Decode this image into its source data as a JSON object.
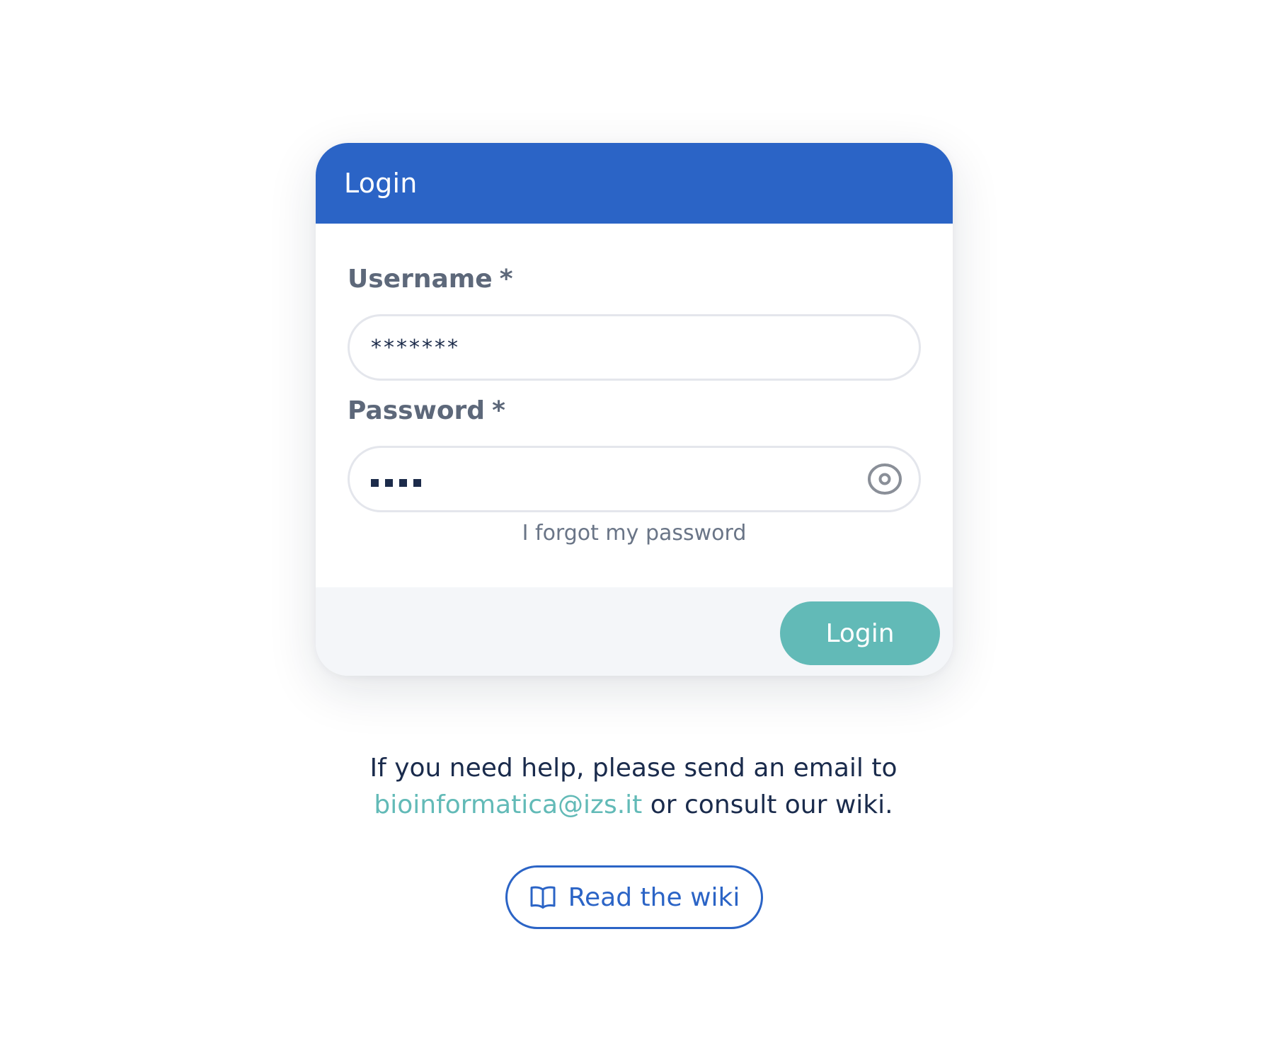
{
  "login_card": {
    "title": "Login",
    "username": {
      "label": "Username",
      "required_mark": "*",
      "value": "*******"
    },
    "password": {
      "label": "Password",
      "required_mark": "*",
      "masked_length": 4,
      "toggle_icon": "eye-icon"
    },
    "forgot_link": "I forgot my password",
    "submit_label": "Login"
  },
  "help": {
    "line1": "If you need help, please send an email to",
    "email": "bioinformatica@izs.it",
    "line2_suffix": " or consult our wiki."
  },
  "wiki_button": {
    "label": "Read the wiki",
    "icon": "book-open-icon"
  },
  "colors": {
    "primary_blue": "#2b64c6",
    "teal_accent": "#62bab7",
    "label_gray": "#5d687a",
    "text_dark": "#1a2b4c",
    "footer_bg": "#f4f6f9"
  }
}
